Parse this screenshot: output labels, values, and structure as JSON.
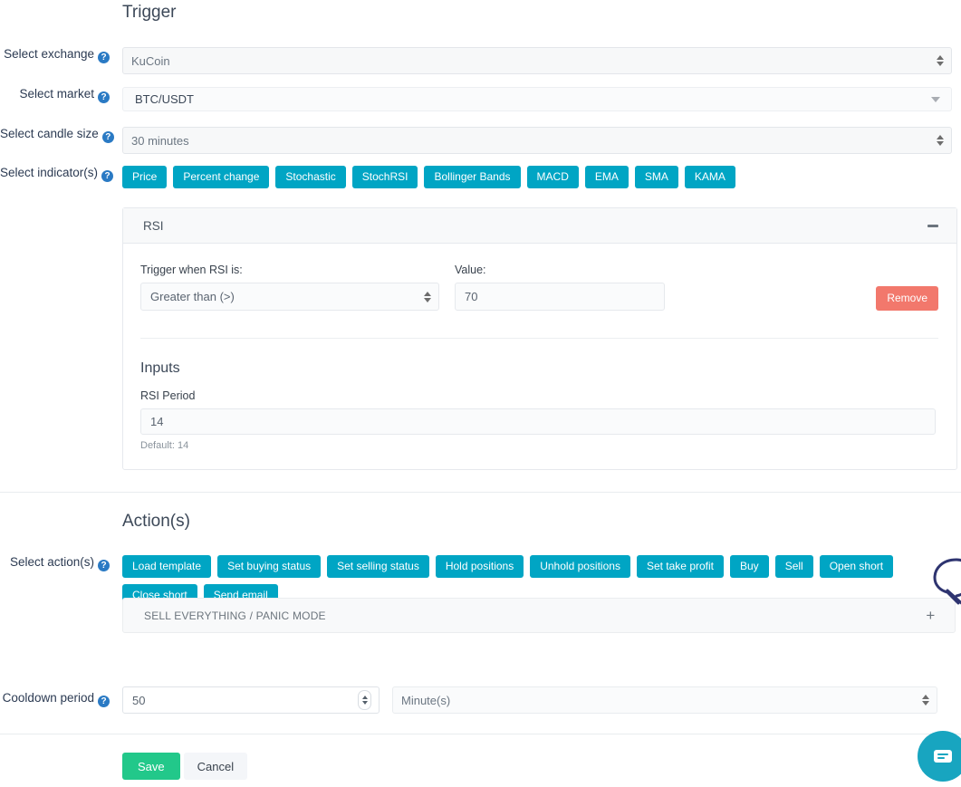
{
  "trigger": {
    "title": "Trigger",
    "exchange": {
      "label": "Select exchange",
      "value": "KuCoin",
      "help": "?"
    },
    "market": {
      "label": "Select market",
      "value": "BTC/USDT",
      "help": "?"
    },
    "candle_size": {
      "label": "Select candle size",
      "value": "30 minutes",
      "help": "?"
    },
    "indicators": {
      "label": "Select indicator(s)",
      "help": "?",
      "buttons": [
        "Price",
        "Percent change",
        "Stochastic",
        "StochRSI",
        "Bollinger Bands",
        "MACD",
        "EMA",
        "SMA",
        "KAMA"
      ]
    }
  },
  "indicator_card": {
    "title": "RSI",
    "collapse_icon": "minus-icon",
    "condition_label": "Trigger when RSI is:",
    "condition_value": "Greater than (>)",
    "value_label": "Value:",
    "value": "70",
    "remove_label": "Remove",
    "inputs_title": "Inputs",
    "period_label": "RSI Period",
    "period_value": "14",
    "period_hint": "Default: 14"
  },
  "actions": {
    "title": "Action(s)",
    "select_label": "Select action(s)",
    "help": "?",
    "buttons": [
      "Load template",
      "Set buying status",
      "Set selling status",
      "Hold positions",
      "Unhold positions",
      "Set take profit",
      "Buy",
      "Sell",
      "Open short",
      "Close short",
      "Send email"
    ],
    "accordion_label": "SELL EVERYTHING / PANIC MODE",
    "accordion_icon": "plus-icon"
  },
  "cooldown": {
    "label": "Cooldown period",
    "help": "?",
    "value": "50",
    "unit": "Minute(s)"
  },
  "footer": {
    "save_label": "Save",
    "cancel_label": "Cancel"
  },
  "chat": {
    "icon": "chat-bubble-icon"
  },
  "colors": {
    "accent_teal": "#00a5c4",
    "remove_red": "#f2786c",
    "save_green": "#22c88a",
    "help_blue": "#2a7ac4",
    "chat_teal": "#18a5c0"
  }
}
